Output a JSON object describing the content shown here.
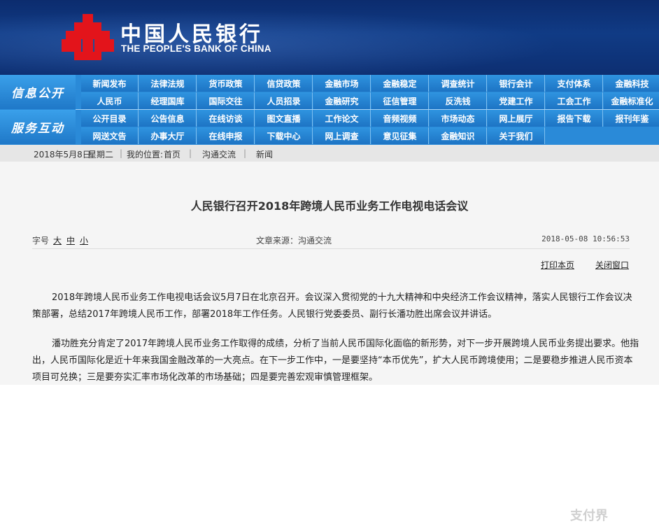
{
  "header": {
    "bank_name_cn": "中国人民银行",
    "bank_name_en": "THE PEOPLE'S BANK OF CHINA",
    "logo_icon": "pboc-logo-icon"
  },
  "nav": {
    "section1_title": "信息公开",
    "section1_items": [
      "新闻发布",
      "法律法规",
      "货币政策",
      "信贷政策",
      "金融市场",
      "金融稳定",
      "调查统计",
      "银行会计",
      "支付体系",
      "金融科技",
      "人民币",
      "经理国库",
      "国际交往",
      "人员招录",
      "金融研究",
      "征信管理",
      "反洗钱",
      "党建工作",
      "工会工作",
      "金融标准化"
    ],
    "section2_title": "服务互动",
    "section2_items": [
      "公开目录",
      "公告信息",
      "在线访谈",
      "图文直播",
      "工作论文",
      "音频视频",
      "市场动态",
      "网上展厅",
      "报告下载",
      "报刊年鉴",
      "网送文告",
      "办事大厅",
      "在线申报",
      "下载中心",
      "网上调查",
      "意见征集",
      "金融知识",
      "关于我们"
    ]
  },
  "breadcrumb": {
    "date": "2018年5月8日",
    "weekday": "星期二",
    "location_label": "我的位置:",
    "home": "首页",
    "level1": "沟通交流",
    "level2": "新闻"
  },
  "article": {
    "title": "人民银行召开2018年跨境人民币业务工作电视电话会议",
    "font_size_label": "字号",
    "font_sizes": [
      "大",
      "中",
      "小"
    ],
    "source": "文章来源：沟通交流",
    "date": "2018-05-08  10:56:53",
    "print_link": "打印本页",
    "close_link": "关闭窗口",
    "para1": "2018年跨境人民币业务工作电视电话会议5月7日在北京召开。会议深入贯彻党的十九大精神和中央经济工作会议精神，落实人民银行工作会议决策部署，总结2017年跨境人民币工作，部署2018年工作任务。人民银行党委委员、副行长潘功胜出席会议并讲话。",
    "para2": "潘功胜充分肯定了2017年跨境人民币业务工作取得的成绩，分析了当前人民币国际化面临的新形势，对下一步开展跨境人民币业务提出要求。他指出，人民币国际化是近十年来我国金融改革的一大亮点。在下一步工作中，一是要坚持“本币优先”，扩大人民币跨境使用；二是要稳步推进人民币资本项目可兑换；三是要夯实汇率市场化改革的市场基础；四是要完善宏观审慎管理框架。"
  },
  "watermark": "支付界"
}
